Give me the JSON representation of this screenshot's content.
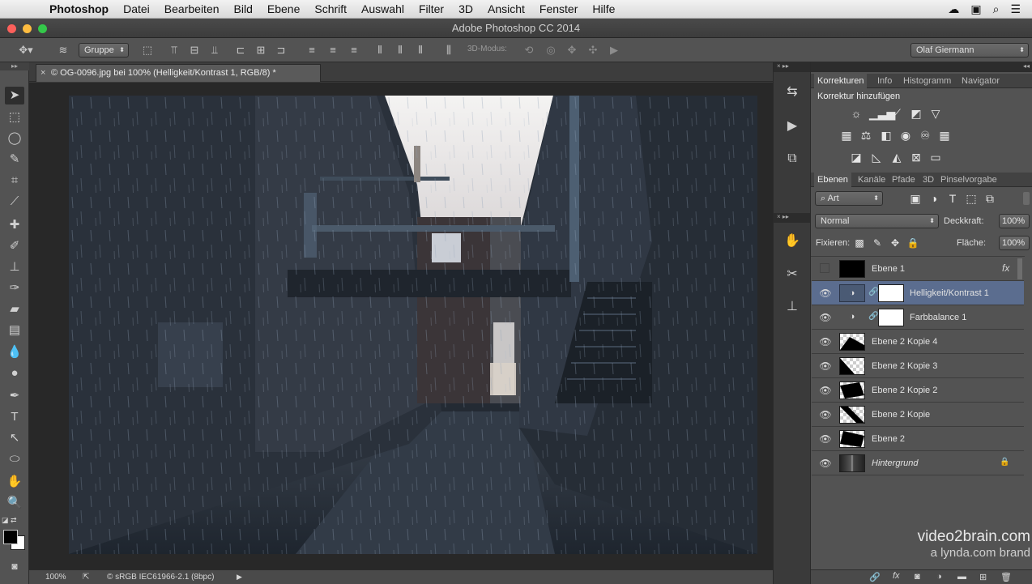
{
  "menubar": {
    "app_name": "Photoshop",
    "items": [
      "Datei",
      "Bearbeiten",
      "Bild",
      "Ebene",
      "Schrift",
      "Auswahl",
      "Filter",
      "3D",
      "Ansicht",
      "Fenster",
      "Hilfe"
    ],
    "status_icons": [
      "creative-cloud-icon",
      "notification-icon",
      "search-icon",
      "list-icon"
    ]
  },
  "window": {
    "title": "Adobe Photoshop CC 2014"
  },
  "options": {
    "auto_select_value": "Gruppe",
    "mode_label": "3D-Modus:",
    "user": "Olaf Giermann"
  },
  "document": {
    "tab_title": "© OG-0096.jpg bei 100% (Helligkeit/Kontrast 1, RGB/8) *"
  },
  "status": {
    "zoom": "100%",
    "profile": "© sRGB IEC61966-2.1 (8bpc)"
  },
  "panels": {
    "top_tabs": [
      "Korrekturen",
      "Info",
      "Histogramm",
      "Navigator"
    ],
    "adjustments_title": "Korrektur hinzufügen",
    "layer_tabs": [
      "Ebenen",
      "Kanäle",
      "Pfade",
      "3D",
      "Pinselvorgabe"
    ],
    "filter_kind": "Art",
    "blend_mode": "Normal",
    "opacity_label": "Deckkraft:",
    "opacity_value": "100%",
    "lock_label": "Fixieren:",
    "fill_label": "Fläche:",
    "fill_value": "100%",
    "layers": [
      {
        "name": "Ebene 1",
        "visible": false,
        "thumb": "black",
        "has_fx": true
      },
      {
        "name": "Helligkeit/Kontrast 1",
        "visible": true,
        "thumb": "adjustment",
        "selected": true
      },
      {
        "name": "Farbbalance 1",
        "visible": true,
        "thumb": "adjustment"
      },
      {
        "name": "Ebene 2 Kopie 4",
        "visible": true,
        "thumb": "mask"
      },
      {
        "name": "Ebene 2 Kopie 3",
        "visible": true,
        "thumb": "mask"
      },
      {
        "name": "Ebene 2 Kopie 2",
        "visible": true,
        "thumb": "mask"
      },
      {
        "name": "Ebene 2 Kopie",
        "visible": true,
        "thumb": "mask"
      },
      {
        "name": "Ebene 2",
        "visible": true,
        "thumb": "mask"
      },
      {
        "name": "Hintergrund",
        "visible": true,
        "thumb": "photo",
        "italic": true,
        "locked": true
      }
    ],
    "fx_label": "fx"
  },
  "watermark": {
    "line1": "video2brain.com",
    "line2": "a lynda.com brand"
  }
}
